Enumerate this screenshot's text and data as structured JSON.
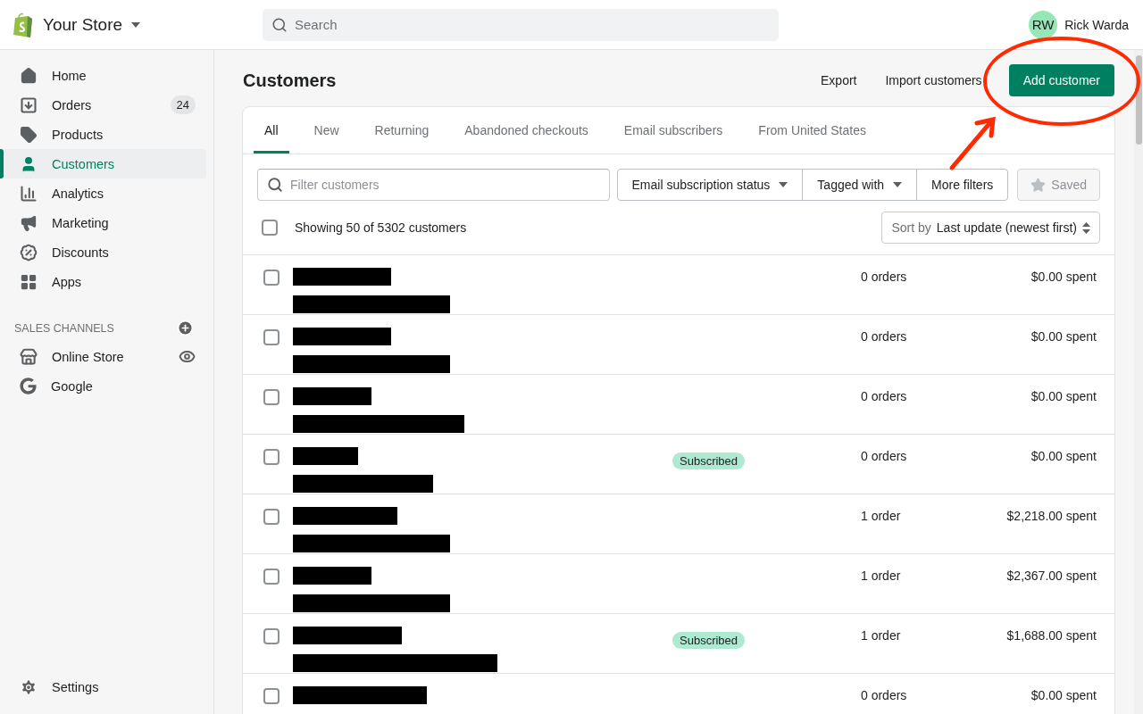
{
  "store": {
    "name": "Your Store"
  },
  "search": {
    "placeholder": "Search"
  },
  "user": {
    "initials": "RW",
    "name": "Rick Warda"
  },
  "sidebar": {
    "items": [
      {
        "label": "Home",
        "selected": false
      },
      {
        "label": "Orders",
        "selected": false,
        "badge": "24"
      },
      {
        "label": "Products",
        "selected": false
      },
      {
        "label": "Customers",
        "selected": true
      },
      {
        "label": "Analytics",
        "selected": false
      },
      {
        "label": "Marketing",
        "selected": false
      },
      {
        "label": "Discounts",
        "selected": false
      },
      {
        "label": "Apps",
        "selected": false
      }
    ],
    "section": {
      "title": "SALES CHANNELS",
      "items": [
        {
          "label": "Online Store",
          "selected": false
        },
        {
          "label": "Google",
          "selected": false
        }
      ]
    },
    "footer": {
      "label": "Settings"
    }
  },
  "page": {
    "title": "Customers",
    "actions": [
      {
        "label": "Export",
        "kind": "plain"
      },
      {
        "label": "Import customers",
        "kind": "plain"
      },
      {
        "label": "Add customer",
        "kind": "primary"
      }
    ]
  },
  "tabs": [
    {
      "label": "All",
      "selected": true
    },
    {
      "label": "New",
      "selected": false
    },
    {
      "label": "Returning",
      "selected": false
    },
    {
      "label": "Abandoned checkouts",
      "selected": false
    },
    {
      "label": "Email subscribers",
      "selected": false
    },
    {
      "label": "From United States",
      "selected": false
    }
  ],
  "filters": {
    "placeholder": "Filter customers",
    "buttons": [
      {
        "label": "Email subscription status",
        "kind": "dropdown"
      },
      {
        "label": "Tagged with",
        "kind": "dropdown"
      },
      {
        "label": "More filters",
        "kind": "plain"
      }
    ],
    "saved": {
      "label": "Saved",
      "disabled": true
    }
  },
  "summary": {
    "checked": false,
    "text": "Showing 50 of 5302 customers"
  },
  "sort": {
    "prefix": "Sort by",
    "value": "Last update (newest first)"
  },
  "rows": [
    {
      "checked": false,
      "redacted": true,
      "orders": "0 orders",
      "spent": "$0.00 spent"
    },
    {
      "checked": false,
      "redacted": true,
      "orders": "0 orders",
      "spent": "$0.00 spent"
    },
    {
      "checked": false,
      "redacted": true,
      "orders": "0 orders",
      "spent": "$0.00 spent"
    },
    {
      "checked": false,
      "redacted": true,
      "badge": "Subscribed",
      "orders": "0 orders",
      "spent": "$0.00 spent"
    },
    {
      "checked": false,
      "redacted": true,
      "orders": "1 order",
      "spent": "$2,218.00 spent"
    },
    {
      "checked": false,
      "redacted": true,
      "orders": "1 order",
      "spent": "$2,367.00 spent"
    },
    {
      "checked": false,
      "redacted": true,
      "badge": "Subscribed",
      "orders": "1 order",
      "spent": "$1,688.00 spent"
    },
    {
      "checked": false,
      "redacted": true,
      "orders": "0 orders",
      "spent": "$0.00 spent"
    }
  ],
  "annotation": {
    "kind": "circle-arrow"
  }
}
